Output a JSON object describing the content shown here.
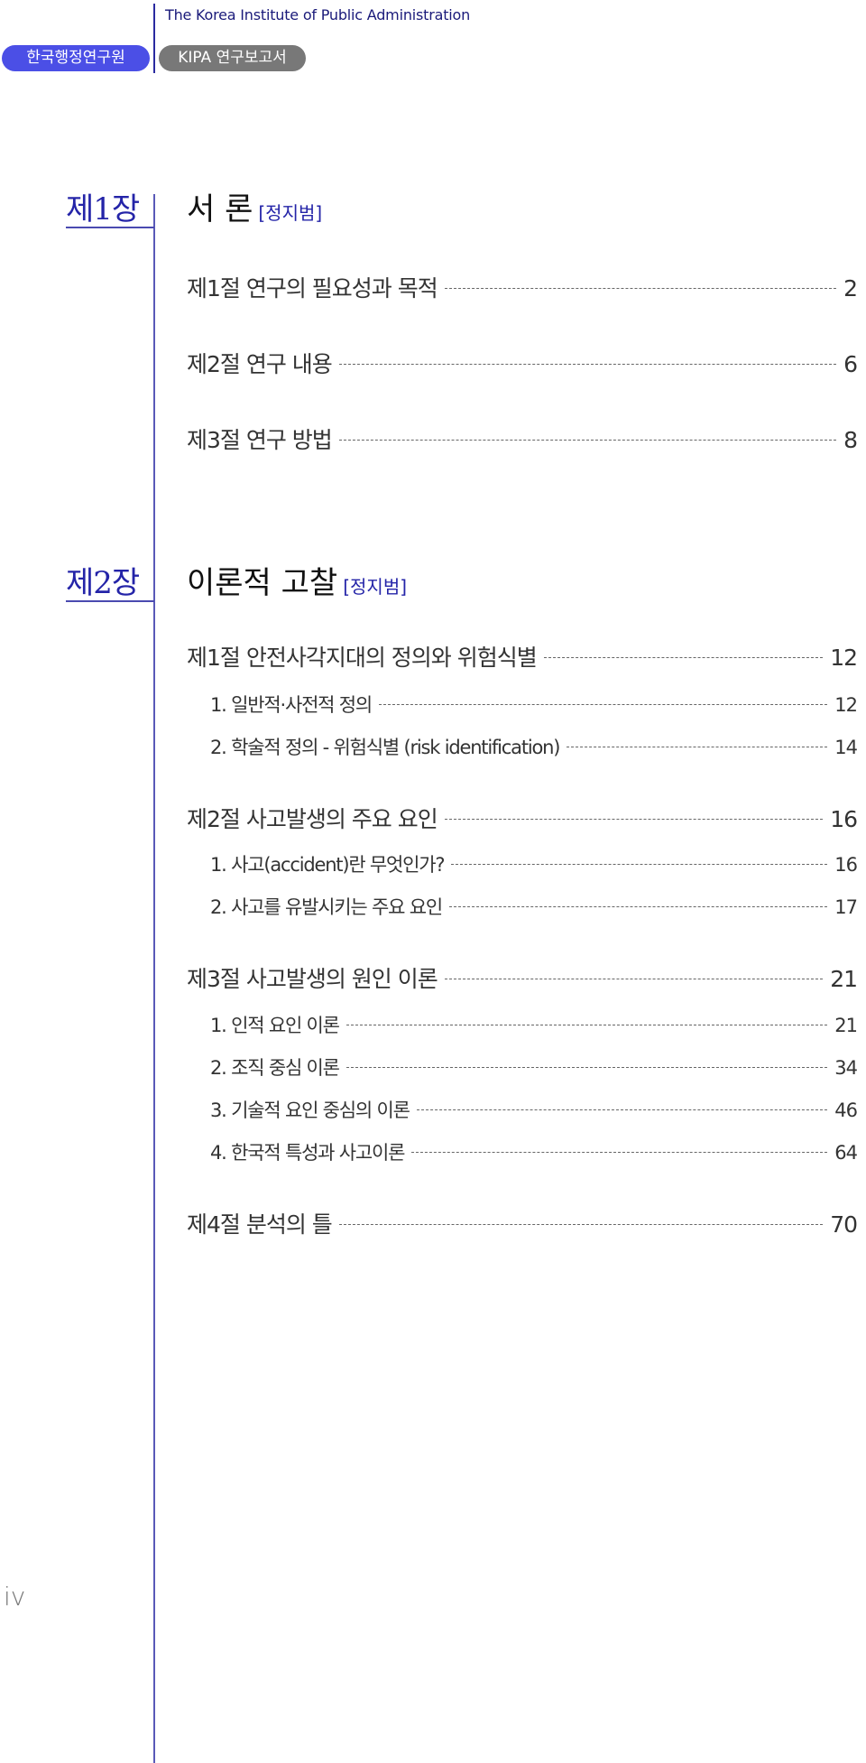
{
  "header": {
    "institute_en": "The Korea Institute of Public Administration",
    "institute_ko": "한국행정연구원",
    "series": "KIPA 연구보고서"
  },
  "colors": {
    "accent_blue": "#4b4fe6",
    "chapter_blue": "#2424a8",
    "gray_pill": "#787878"
  },
  "chapters": [
    {
      "label": "제1장",
      "title": "서 론",
      "author": "[정지범]",
      "sections": [
        {
          "title": "제1절 연구의 필요성과 목적",
          "page": "2",
          "items": []
        },
        {
          "title": "제2절 연구 내용",
          "page": "6",
          "items": []
        },
        {
          "title": "제3절 연구 방법",
          "page": "8",
          "items": []
        }
      ]
    },
    {
      "label": "제2장",
      "title": "이론적 고찰",
      "author": "[정지범]",
      "sections": [
        {
          "title": "제1절 안전사각지대의 정의와 위험식별",
          "page": "12",
          "items": [
            {
              "title": "1. 일반적·사전적 정의",
              "page": "12"
            },
            {
              "title": "2. 학술적 정의 - 위험식별 (risk identification)",
              "page": "14"
            }
          ]
        },
        {
          "title": "제2절 사고발생의 주요 요인",
          "page": "16",
          "items": [
            {
              "title": "1. 사고(accident)란 무엇인가?",
              "page": "16"
            },
            {
              "title": "2. 사고를 유발시키는 주요 요인",
              "page": "17"
            }
          ]
        },
        {
          "title": "제3절 사고발생의 원인 이론",
          "page": "21",
          "items": [
            {
              "title": "1. 인적 요인 이론",
              "page": "21"
            },
            {
              "title": "2. 조직 중심 이론",
              "page": "34"
            },
            {
              "title": "3. 기술적 요인 중심의 이론",
              "page": "46"
            },
            {
              "title": "4. 한국적 특성과 사고이론",
              "page": "64"
            }
          ]
        },
        {
          "title": "제4절 분석의 틀",
          "page": "70",
          "items": []
        }
      ]
    }
  ],
  "page_number": "iv"
}
